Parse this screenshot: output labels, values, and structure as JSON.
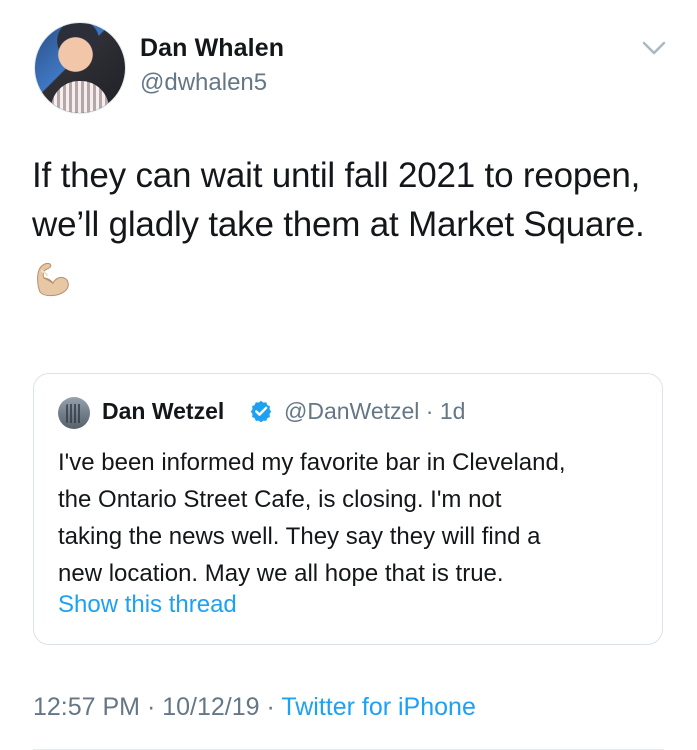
{
  "tweet": {
    "author": {
      "display_name": "Dan Whalen",
      "handle": "@dwhalen5",
      "avatar_icon": "profile-photo"
    },
    "text": "If they can wait until fall 2021 to reopen,\nwe’ll gladly take them at Market Square.",
    "emoji_icon": "flexed-biceps-icon",
    "quoted_tweet": {
      "author": {
        "display_name": "Dan Wetzel",
        "handle_time": "@DanWetzel · 1d",
        "avatar_icon": "profile-photo",
        "verified_icon": "verified-badge-icon"
      },
      "text": "I've been informed my favorite bar in Cleveland,\nthe Ontario Street Cafe, is closing. I'm not\ntaking the news well. They say they will find a\nnew location. May we all hope that is true.",
      "show_thread_label": "Show this thread"
    },
    "footer": {
      "time_date": "12:57 PM · 10/12/19 · ",
      "source": "Twitter for iPhone"
    }
  },
  "colors": {
    "text_primary": "#14171a",
    "text_secondary": "#657786",
    "accent_blue": "#1da1f2",
    "border": "#dbe3ea"
  }
}
